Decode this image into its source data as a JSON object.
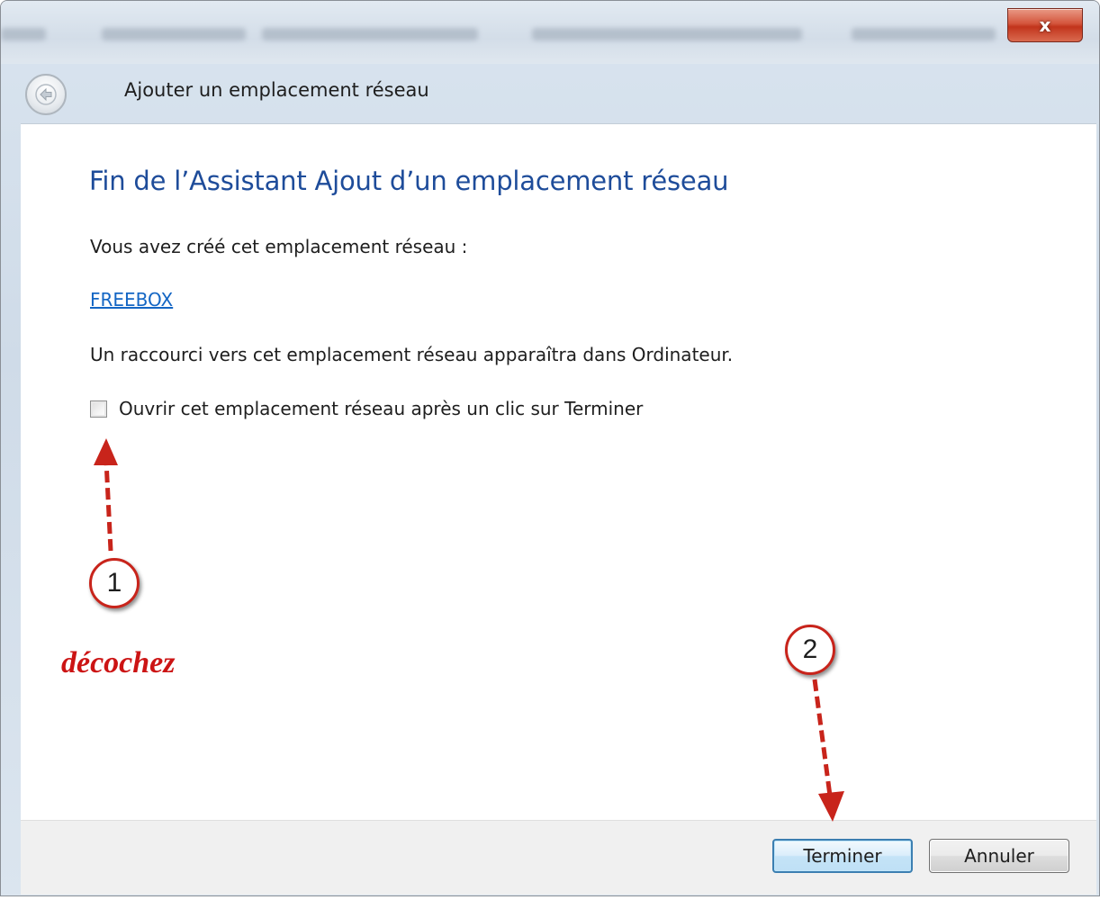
{
  "window": {
    "close_label": "x"
  },
  "nav": {
    "title": "Ajouter un emplacement réseau"
  },
  "wizard": {
    "heading": "Fin de l’Assistant Ajout d’un emplacement réseau",
    "created_text": "Vous avez créé cet emplacement réseau :",
    "location_link": "FREEBOX",
    "shortcut_text": "Un raccourci vers cet emplacement réseau apparaîtra dans Ordinateur.",
    "open_checkbox": {
      "label": "Ouvrir cet emplacement réseau après un clic sur Terminer",
      "checked": false
    }
  },
  "footer": {
    "finish_label": "Terminer",
    "cancel_label": "Annuler"
  },
  "annotations": {
    "step1_number": "1",
    "step2_number": "2",
    "step1_caption": "décochez",
    "accent_color": "#c8241b"
  },
  "icons": {
    "back": "back-arrow-icon",
    "close": "close-icon"
  }
}
